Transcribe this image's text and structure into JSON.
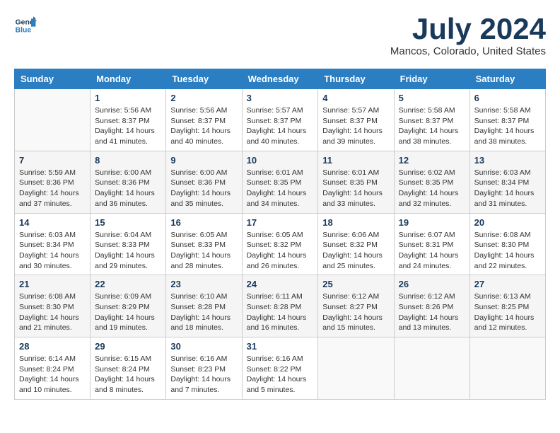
{
  "header": {
    "logo_line1": "General",
    "logo_line2": "Blue",
    "month": "July 2024",
    "location": "Mancos, Colorado, United States"
  },
  "days_of_week": [
    "Sunday",
    "Monday",
    "Tuesday",
    "Wednesday",
    "Thursday",
    "Friday",
    "Saturday"
  ],
  "weeks": [
    [
      {
        "num": "",
        "info": ""
      },
      {
        "num": "1",
        "info": "Sunrise: 5:56 AM\nSunset: 8:37 PM\nDaylight: 14 hours\nand 41 minutes."
      },
      {
        "num": "2",
        "info": "Sunrise: 5:56 AM\nSunset: 8:37 PM\nDaylight: 14 hours\nand 40 minutes."
      },
      {
        "num": "3",
        "info": "Sunrise: 5:57 AM\nSunset: 8:37 PM\nDaylight: 14 hours\nand 40 minutes."
      },
      {
        "num": "4",
        "info": "Sunrise: 5:57 AM\nSunset: 8:37 PM\nDaylight: 14 hours\nand 39 minutes."
      },
      {
        "num": "5",
        "info": "Sunrise: 5:58 AM\nSunset: 8:37 PM\nDaylight: 14 hours\nand 38 minutes."
      },
      {
        "num": "6",
        "info": "Sunrise: 5:58 AM\nSunset: 8:37 PM\nDaylight: 14 hours\nand 38 minutes."
      }
    ],
    [
      {
        "num": "7",
        "info": "Sunrise: 5:59 AM\nSunset: 8:36 PM\nDaylight: 14 hours\nand 37 minutes."
      },
      {
        "num": "8",
        "info": "Sunrise: 6:00 AM\nSunset: 8:36 PM\nDaylight: 14 hours\nand 36 minutes."
      },
      {
        "num": "9",
        "info": "Sunrise: 6:00 AM\nSunset: 8:36 PM\nDaylight: 14 hours\nand 35 minutes."
      },
      {
        "num": "10",
        "info": "Sunrise: 6:01 AM\nSunset: 8:35 PM\nDaylight: 14 hours\nand 34 minutes."
      },
      {
        "num": "11",
        "info": "Sunrise: 6:01 AM\nSunset: 8:35 PM\nDaylight: 14 hours\nand 33 minutes."
      },
      {
        "num": "12",
        "info": "Sunrise: 6:02 AM\nSunset: 8:35 PM\nDaylight: 14 hours\nand 32 minutes."
      },
      {
        "num": "13",
        "info": "Sunrise: 6:03 AM\nSunset: 8:34 PM\nDaylight: 14 hours\nand 31 minutes."
      }
    ],
    [
      {
        "num": "14",
        "info": "Sunrise: 6:03 AM\nSunset: 8:34 PM\nDaylight: 14 hours\nand 30 minutes."
      },
      {
        "num": "15",
        "info": "Sunrise: 6:04 AM\nSunset: 8:33 PM\nDaylight: 14 hours\nand 29 minutes."
      },
      {
        "num": "16",
        "info": "Sunrise: 6:05 AM\nSunset: 8:33 PM\nDaylight: 14 hours\nand 28 minutes."
      },
      {
        "num": "17",
        "info": "Sunrise: 6:05 AM\nSunset: 8:32 PM\nDaylight: 14 hours\nand 26 minutes."
      },
      {
        "num": "18",
        "info": "Sunrise: 6:06 AM\nSunset: 8:32 PM\nDaylight: 14 hours\nand 25 minutes."
      },
      {
        "num": "19",
        "info": "Sunrise: 6:07 AM\nSunset: 8:31 PM\nDaylight: 14 hours\nand 24 minutes."
      },
      {
        "num": "20",
        "info": "Sunrise: 6:08 AM\nSunset: 8:30 PM\nDaylight: 14 hours\nand 22 minutes."
      }
    ],
    [
      {
        "num": "21",
        "info": "Sunrise: 6:08 AM\nSunset: 8:30 PM\nDaylight: 14 hours\nand 21 minutes."
      },
      {
        "num": "22",
        "info": "Sunrise: 6:09 AM\nSunset: 8:29 PM\nDaylight: 14 hours\nand 19 minutes."
      },
      {
        "num": "23",
        "info": "Sunrise: 6:10 AM\nSunset: 8:28 PM\nDaylight: 14 hours\nand 18 minutes."
      },
      {
        "num": "24",
        "info": "Sunrise: 6:11 AM\nSunset: 8:28 PM\nDaylight: 14 hours\nand 16 minutes."
      },
      {
        "num": "25",
        "info": "Sunrise: 6:12 AM\nSunset: 8:27 PM\nDaylight: 14 hours\nand 15 minutes."
      },
      {
        "num": "26",
        "info": "Sunrise: 6:12 AM\nSunset: 8:26 PM\nDaylight: 14 hours\nand 13 minutes."
      },
      {
        "num": "27",
        "info": "Sunrise: 6:13 AM\nSunset: 8:25 PM\nDaylight: 14 hours\nand 12 minutes."
      }
    ],
    [
      {
        "num": "28",
        "info": "Sunrise: 6:14 AM\nSunset: 8:24 PM\nDaylight: 14 hours\nand 10 minutes."
      },
      {
        "num": "29",
        "info": "Sunrise: 6:15 AM\nSunset: 8:24 PM\nDaylight: 14 hours\nand 8 minutes."
      },
      {
        "num": "30",
        "info": "Sunrise: 6:16 AM\nSunset: 8:23 PM\nDaylight: 14 hours\nand 7 minutes."
      },
      {
        "num": "31",
        "info": "Sunrise: 6:16 AM\nSunset: 8:22 PM\nDaylight: 14 hours\nand 5 minutes."
      },
      {
        "num": "",
        "info": ""
      },
      {
        "num": "",
        "info": ""
      },
      {
        "num": "",
        "info": ""
      }
    ]
  ]
}
